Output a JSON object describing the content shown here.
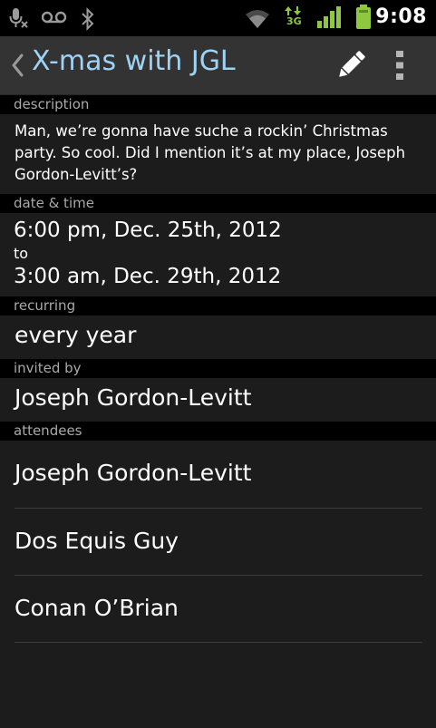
{
  "status_bar": {
    "time": "9:08",
    "icons": [
      "microphone-muted-icon",
      "voicemail-icon",
      "bluetooth-icon",
      "wifi-icon",
      "3g-data-icon",
      "signal-icon",
      "battery-icon"
    ],
    "network_label": "3G",
    "accent_color": "#8fc73e"
  },
  "action_bar": {
    "title": "X-mas with JGL",
    "title_color": "#9fd3f5",
    "icons": [
      "back-chevron-icon",
      "pencil-edit-icon",
      "overflow-menu-icon"
    ]
  },
  "sections": {
    "description": {
      "header": "description",
      "text": "Man, we’re gonna have suche a rockin’ Christmas party. So cool. Did I mention it’s at my place, Joseph Gordon-Levitt’s?"
    },
    "date_time": {
      "header": "date & time",
      "start": "6:00 pm, Dec. 25th, 2012",
      "separator": "to",
      "end": "3:00 am, Dec. 29th, 2012"
    },
    "recurring": {
      "header": "recurring",
      "value": "every year"
    },
    "invited_by": {
      "header": "invited by",
      "value": "Joseph Gordon-Levitt"
    },
    "attendees": {
      "header": "attendees",
      "items": [
        "Joseph Gordon-Levitt",
        "Dos Equis Guy",
        "Conan O’Brian"
      ]
    }
  }
}
